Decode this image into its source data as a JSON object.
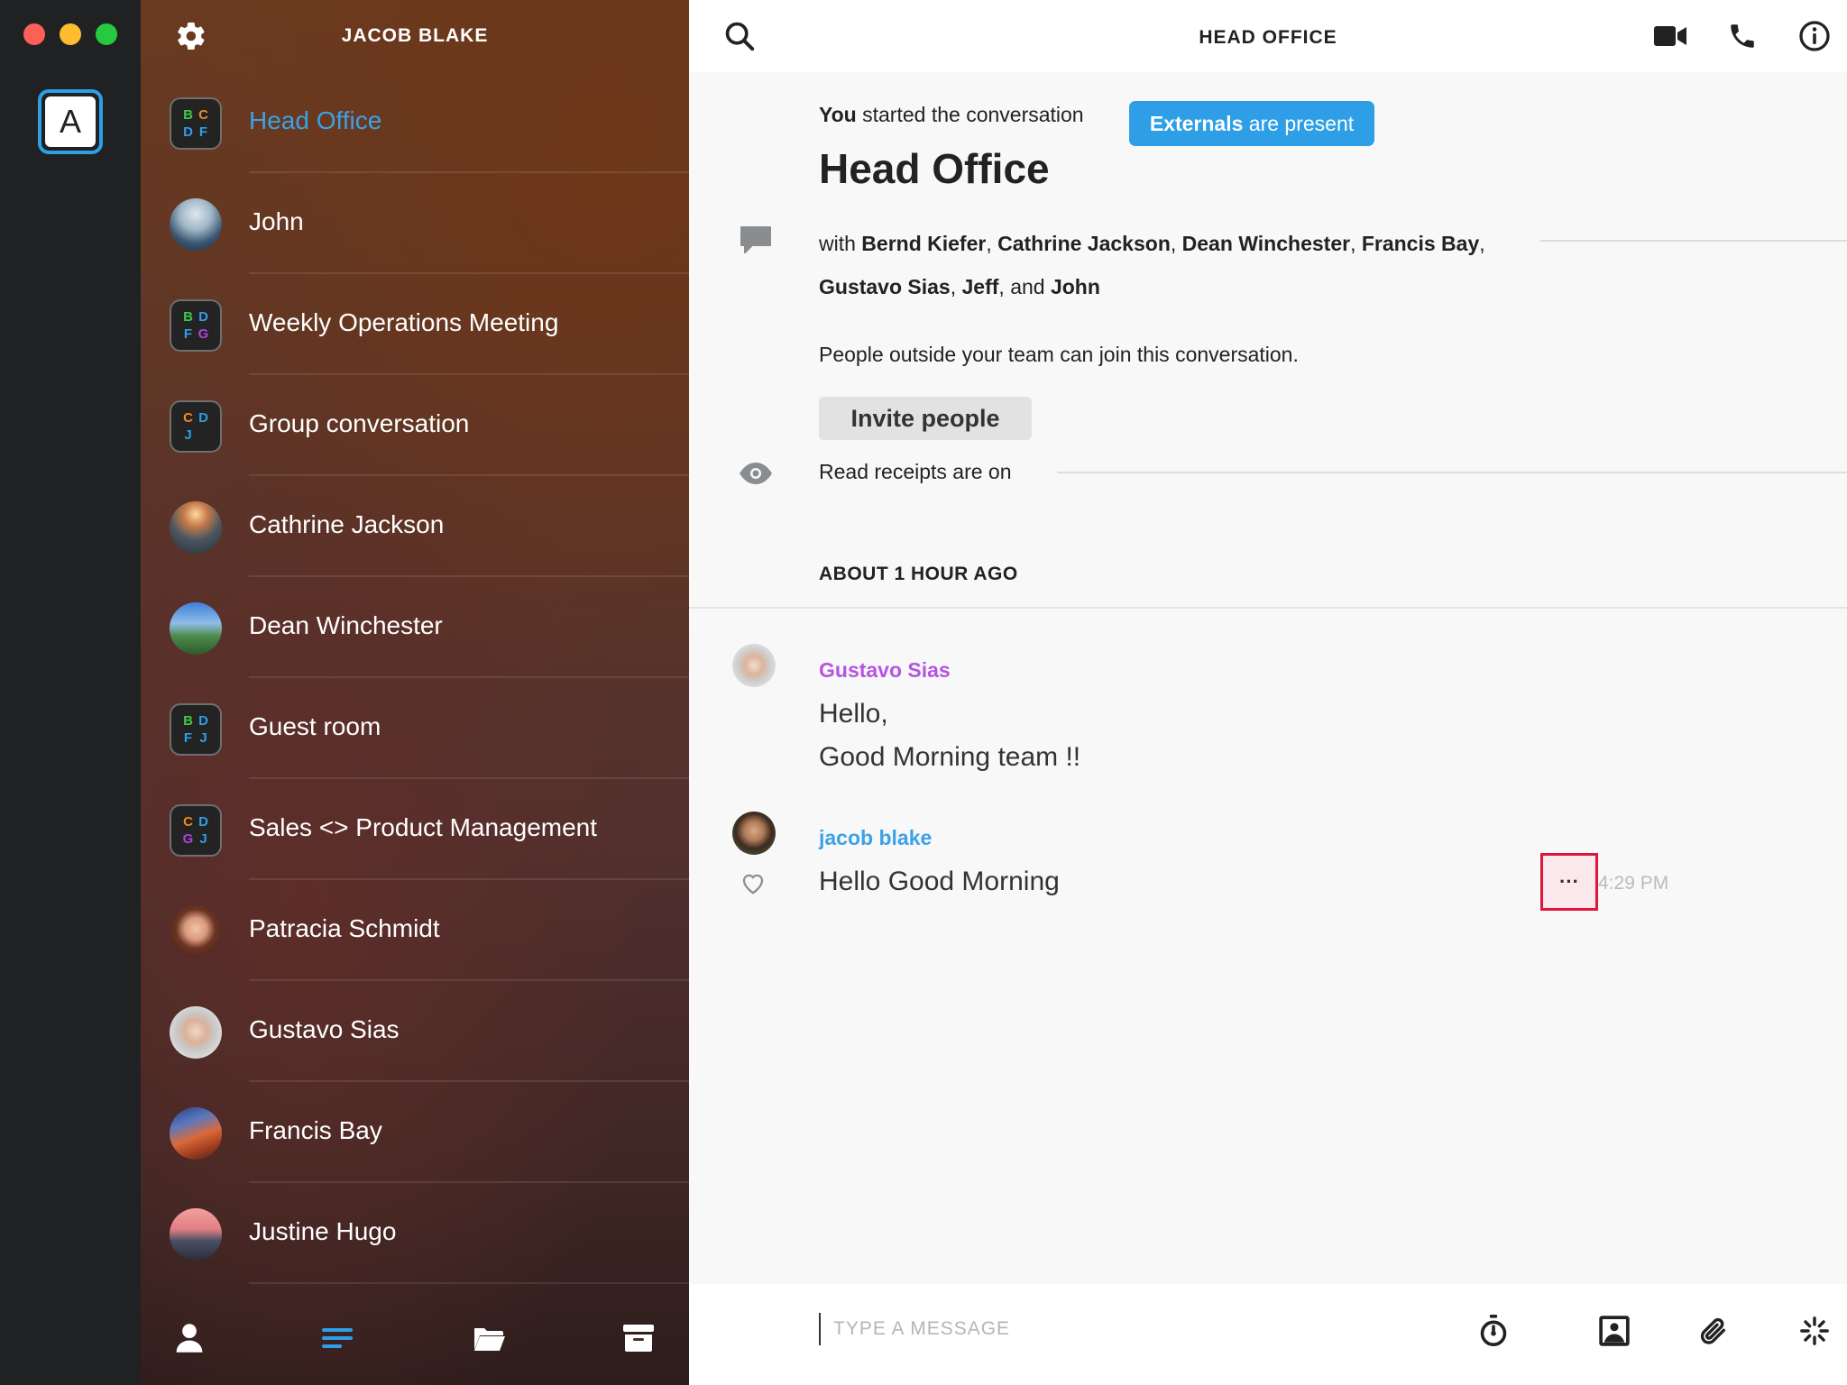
{
  "window": {
    "account_initial": "A"
  },
  "sidebar": {
    "user_name": "JACOB BLAKE",
    "conversations": [
      {
        "label": "Head Office",
        "kind": "group",
        "active": true,
        "letters": [
          "B",
          "C",
          "D",
          "F"
        ]
      },
      {
        "label": "John",
        "kind": "person"
      },
      {
        "label": "Weekly Operations Meeting",
        "kind": "group",
        "letters": [
          "B",
          "D",
          "F",
          "G"
        ]
      },
      {
        "label": "Group conversation",
        "kind": "group",
        "letters": [
          "C",
          "D",
          "J",
          ""
        ]
      },
      {
        "label": "Cathrine Jackson",
        "kind": "person"
      },
      {
        "label": "Dean Winchester",
        "kind": "person"
      },
      {
        "label": "Guest room",
        "kind": "group",
        "letters": [
          "B",
          "D",
          "F",
          "J"
        ]
      },
      {
        "label": "Sales <> Product Management",
        "kind": "group",
        "letters": [
          "C",
          "D",
          "G",
          "J"
        ]
      },
      {
        "label": "Patracia Schmidt",
        "kind": "person"
      },
      {
        "label": "Gustavo Sias",
        "kind": "person"
      },
      {
        "label": "Francis Bay",
        "kind": "person"
      },
      {
        "label": "Justine Hugo",
        "kind": "person"
      }
    ],
    "letter_colors": {
      "B": "#3ec84a",
      "C": "#f28a1c",
      "D": "#2e9fe6",
      "F": "#2e9fe6",
      "G": "#b040e0",
      "J": "#2e9fe6"
    },
    "footer_icons": [
      "person-icon",
      "conversations-icon",
      "folder-icon",
      "archive-icon"
    ]
  },
  "conversation": {
    "title_bar": "HEAD OFFICE",
    "started_by": "You",
    "started_suffix": " started the conversation",
    "externals_badge": {
      "strong": "Externals",
      "rest": " are present"
    },
    "title": "Head Office",
    "participants_prefix": "with ",
    "participants": [
      "Bernd Kiefer",
      "Cathrine Jackson",
      "Dean Winchester",
      "Francis Bay",
      "Gustavo Sias",
      "Jeff",
      "John"
    ],
    "participants_conjunction": "and",
    "outside_note": "People outside your team can join this conversation.",
    "invite_button": "Invite people",
    "read_receipts": "Read receipts are on",
    "time_separator": "ABOUT 1 HOUR AGO",
    "messages": [
      {
        "author": "Gustavo Sias",
        "author_color": "#b555e0",
        "lines": [
          "Hello,",
          "Good Morning team !!"
        ]
      },
      {
        "author": "jacob blake",
        "author_color": "#3ba1e8",
        "lines": [
          "Hello Good Morning"
        ],
        "time": "4:29 PM",
        "options_label": "···"
      }
    ],
    "composer_placeholder": "TYPE A MESSAGE"
  },
  "colors": {
    "accent": "#2e9fe6",
    "highlight": "#e0143c"
  }
}
